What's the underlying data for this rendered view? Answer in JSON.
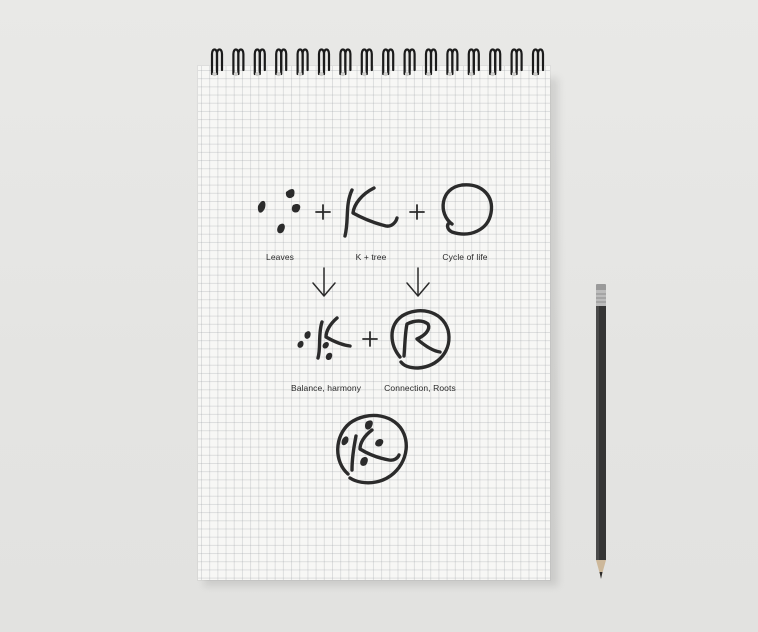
{
  "diagram": {
    "row1": {
      "labels": [
        "Leaves",
        "K + tree",
        "Cycle of life"
      ],
      "operators": [
        "+",
        "+"
      ]
    },
    "row2": {
      "labels": [
        "Balance, harmony",
        "Connection, Roots"
      ],
      "operators": [
        "+"
      ]
    },
    "arrow_icon": "down-arrow-icon"
  },
  "colors": {
    "ink": "#2b2b2b",
    "paper": "#f7f7f5",
    "grid": "#b9bcc0",
    "background": "#e6e6e4",
    "pencil": "#3a3a3a"
  }
}
